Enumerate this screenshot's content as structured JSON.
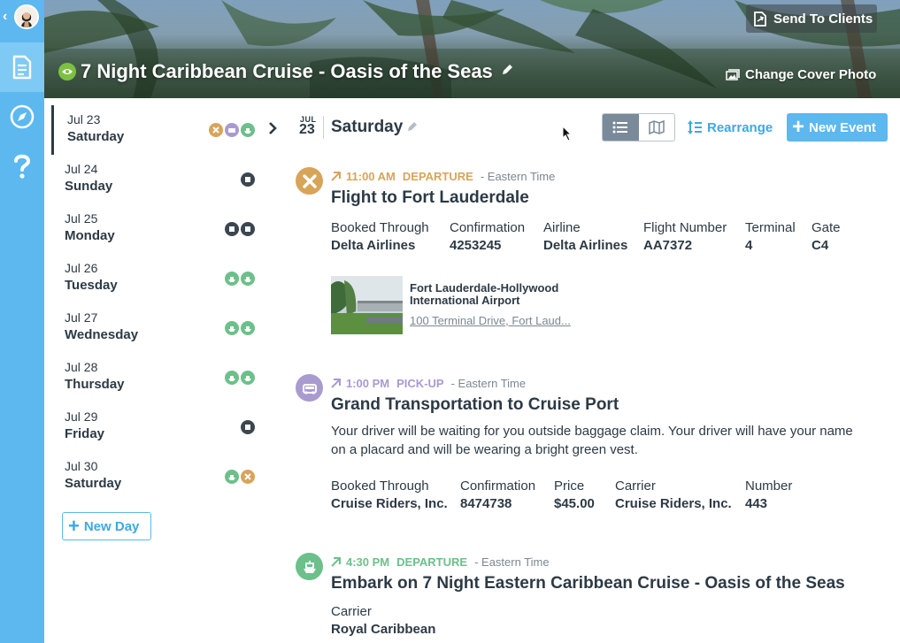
{
  "header": {
    "trip_title": "7 Night Caribbean Cruise - Oasis of the Seas",
    "send_to_clients": "Send To Clients",
    "change_cover": "Change Cover Photo"
  },
  "days": [
    {
      "date": "Jul 23",
      "name": "Saturday",
      "icons": [
        "flight",
        "car",
        "ship"
      ],
      "selected": true
    },
    {
      "date": "Jul 24",
      "name": "Sunday",
      "icons": [
        "dark"
      ]
    },
    {
      "date": "Jul 25",
      "name": "Monday",
      "icons": [
        "dark",
        "dark"
      ]
    },
    {
      "date": "Jul 26",
      "name": "Tuesday",
      "icons": [
        "ship",
        "ship"
      ]
    },
    {
      "date": "Jul 27",
      "name": "Wednesday",
      "icons": [
        "ship",
        "ship"
      ]
    },
    {
      "date": "Jul 28",
      "name": "Thursday",
      "icons": [
        "ship",
        "ship"
      ]
    },
    {
      "date": "Jul 29",
      "name": "Friday",
      "icons": [
        "dark"
      ]
    },
    {
      "date": "Jul 30",
      "name": "Saturday",
      "icons": [
        "ship",
        "flight"
      ]
    }
  ],
  "sidebar": {
    "new_day": "New Day"
  },
  "day_header": {
    "month": "JUL",
    "day": "23",
    "name": "Saturday",
    "rearrange": "Rearrange",
    "new_event": "New Event"
  },
  "events": [
    {
      "time": "11:00 AM",
      "type": "DEPARTURE",
      "tz": "- Eastern Time",
      "title": "Flight to Fort Lauderdale",
      "fields": [
        {
          "label": "Booked Through",
          "value": "Delta Airlines"
        },
        {
          "label": "Confirmation",
          "value": "4253245"
        },
        {
          "label": "Airline",
          "value": "Delta Airlines"
        },
        {
          "label": "Flight Number",
          "value": "AA7372"
        },
        {
          "label": "Terminal",
          "value": "4"
        },
        {
          "label": "Gate",
          "value": "C4"
        }
      ],
      "place": {
        "name": "Fort Lauderdale-Hollywood International Airport",
        "address": "100 Terminal Drive, Fort Laud..."
      }
    },
    {
      "time": "1:00 PM",
      "type": "PICK-UP",
      "tz": "- Eastern Time",
      "title": "Grand Transportation to Cruise Port",
      "description": "Your driver will be waiting for you outside baggage claim. Your driver will have your name on a placard and will be wearing a bright green vest.",
      "fields": [
        {
          "label": "Booked Through",
          "value": "Cruise Riders, Inc."
        },
        {
          "label": "Confirmation",
          "value": "8474738"
        },
        {
          "label": "Price",
          "value": "$45.00"
        },
        {
          "label": "Carrier",
          "value": "Cruise Riders, Inc."
        },
        {
          "label": "Number",
          "value": "443"
        }
      ]
    },
    {
      "time": "4:30 PM",
      "type": "DEPARTURE",
      "tz": "- Eastern Time",
      "title": "Embark on 7 Night Eastern Caribbean Cruise - Oasis of the Seas",
      "fields": [
        {
          "label": "Carrier",
          "value": "Royal Caribbean"
        }
      ]
    }
  ],
  "colors": {
    "rail": "#5cb8ef",
    "accent": "#3da8e6",
    "flight": "#d8a458",
    "car": "#a99ad0",
    "ship": "#6cc08a",
    "text": "#2c3a45"
  }
}
